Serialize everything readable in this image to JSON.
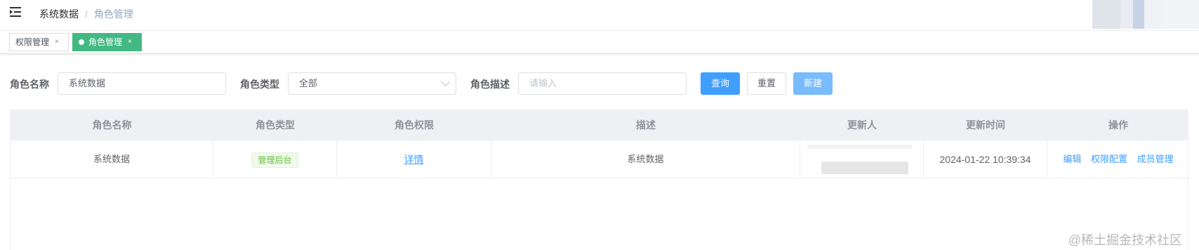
{
  "breadcrumb": {
    "root": "系统数据",
    "separator": "/",
    "current": "角色管理"
  },
  "tabs": [
    {
      "label": "权限管理",
      "close": "×",
      "active": false
    },
    {
      "label": "角色管理",
      "close": "×",
      "active": true
    }
  ],
  "filters": {
    "role_name": {
      "label": "角色名称",
      "value": "系统数据"
    },
    "role_type": {
      "label": "角色类型",
      "value": "全部"
    },
    "role_desc": {
      "label": "角色描述",
      "placeholder": "请输入"
    }
  },
  "buttons": {
    "query": "查询",
    "reset": "重置",
    "create": "新建"
  },
  "table": {
    "columns": [
      "角色名称",
      "角色类型",
      "角色权限",
      "描述",
      "更新人",
      "更新时间",
      "操作"
    ],
    "rows": [
      {
        "name": "系统数据",
        "type": "管理后台",
        "permission": "详情",
        "description": "系统数据",
        "updater": "",
        "updated_at": "2024-01-22 10:39:34",
        "actions": [
          "编辑",
          "权限配置",
          "成员管理"
        ]
      }
    ]
  },
  "watermark": "@稀土掘金技术社区",
  "colors": {
    "primary": "#409eff",
    "active_tab": "#42b983",
    "tag_green": "#67c23a"
  },
  "icons": {
    "menu": "hamburger-icon",
    "select": "chevron-down-icon"
  }
}
